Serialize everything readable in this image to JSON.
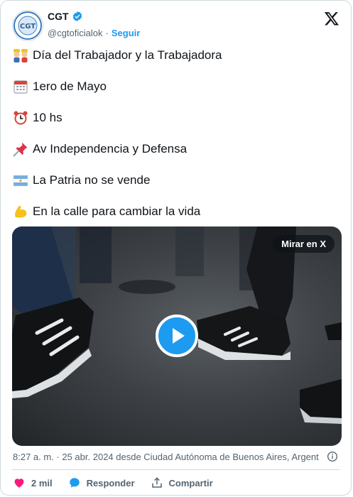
{
  "author": {
    "name": "CGT",
    "handle": "@cgtoficialok",
    "separator": "·",
    "follow_label": "Seguir"
  },
  "lines": [
    {
      "icon": "worker-emoji",
      "text": "Día del Trabajador y la Trabajadora"
    },
    {
      "icon": "calendar-emoji",
      "text": "1ero de Mayo"
    },
    {
      "icon": "alarm-clock-emoji",
      "text": "10 hs"
    },
    {
      "icon": "pushpin-emoji",
      "text": "Av Independencia y Defensa"
    },
    {
      "icon": "argentina-flag-emoji",
      "text": "La Patria no se vende"
    },
    {
      "icon": "flexed-biceps-emoji",
      "text": "En la calle para cambiar la vida"
    }
  ],
  "media": {
    "watch_label": "Mirar en X"
  },
  "meta": "8:27 a. m. · 25 abr. 2024 desde Ciudad Autónoma de Buenos Aires, Argent",
  "actions": {
    "likes": "2 mil",
    "reply": "Responder",
    "share": "Compartir"
  },
  "colors": {
    "accent": "#1d9bf0",
    "like": "#f91880",
    "text": "#0f1419",
    "muted": "#536471"
  }
}
